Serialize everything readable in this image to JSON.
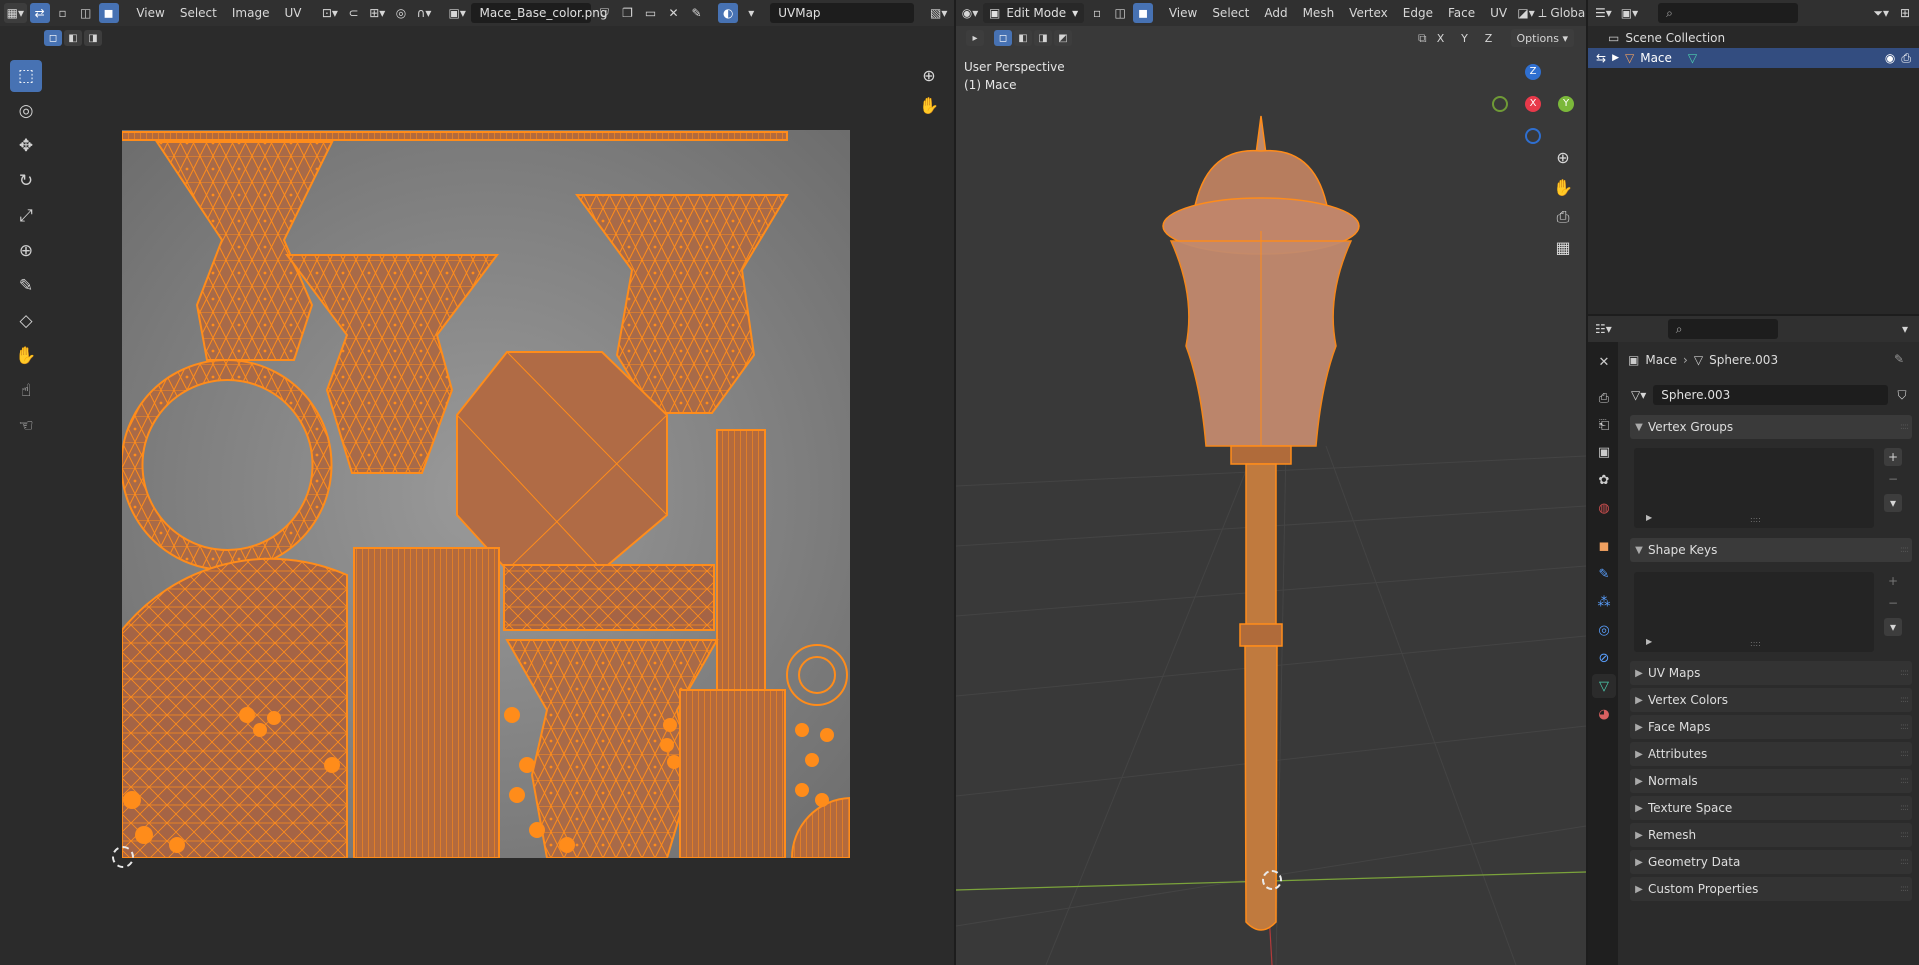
{
  "uv_editor": {
    "menus": [
      "View",
      "Select",
      "Image",
      "UV"
    ],
    "image_name": "Mace_Base_color.png",
    "uv_map_name": "UVMap"
  },
  "viewport": {
    "mode": "Edit Mode",
    "menus": [
      "View",
      "Select",
      "Add",
      "Mesh",
      "Vertex",
      "Edge",
      "Face",
      "UV"
    ],
    "orientation": "Global",
    "options_label": "Options",
    "axis_toggles": [
      "X",
      "Y",
      "Z"
    ],
    "perspective_label": "User Perspective",
    "object_label": "(1) Mace",
    "gizmo": {
      "z": "Z",
      "x": "X",
      "y": "Y"
    }
  },
  "outliner": {
    "scene_collection": "Scene Collection",
    "object_name": "Mace"
  },
  "properties": {
    "breadcrumb_object": "Mace",
    "breadcrumb_data": "Sphere.003",
    "datablock_name": "Sphere.003",
    "panels_open": [
      "Vertex Groups",
      "Shape Keys"
    ],
    "panels_closed": [
      "UV Maps",
      "Vertex Colors",
      "Face Maps",
      "Attributes",
      "Normals",
      "Texture Space",
      "Remesh",
      "Geometry Data",
      "Custom Properties"
    ]
  },
  "colors": {
    "accent": "#4772b3",
    "uv_orange": "#ff8c1a",
    "header_bg": "#303030",
    "editor_bg": "#2b2b2b",
    "viewport_bg": "#393939"
  }
}
